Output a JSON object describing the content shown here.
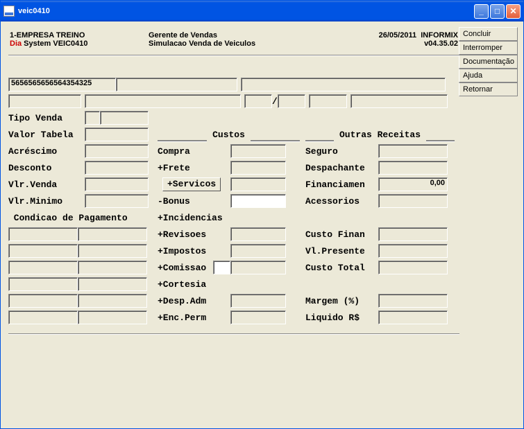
{
  "window": {
    "title": "veic0410"
  },
  "sidebar": {
    "concluir": "Concluir",
    "interromper": "Interromper",
    "documentacao": "Documentação",
    "ajuda": "Ajuda",
    "retornar": "Retornar"
  },
  "header": {
    "company": "1-EMPRESA TREINO",
    "role": "Gerente de Vendas",
    "date": "26/05/2011",
    "db": "INFORMIX",
    "dia": "Dia",
    "sys": " System  VEIC0410",
    "screen": "Simulacao Venda de Veiculos",
    "version": "v04.35.02"
  },
  "fields": {
    "big_input": "5656565656564354325",
    "slash": "/",
    "tipo_venda": "Tipo Venda",
    "valor_tabela": "Valor Tabela",
    "acrescimo": "Acréscimo",
    "desconto": "Desconto",
    "vlr_venda": "Vlr.Venda",
    "vlr_minimo": "Vlr.Minimo",
    "condicao": " Condicao de Pagamento",
    "custos_title": " Custos ",
    "compra": "Compra",
    "frete": "+Frete",
    "servicos": "+Servicos",
    "bonus": "-Bonus",
    "incidencias": "+Incidencias",
    "revisoes": "+Revisoes",
    "impostos": "+Impostos",
    "comissao": "+Comissao",
    "cortesia": "+Cortesia",
    "desp_adm": "+Desp.Adm",
    "enc_perm": "+Enc.Perm",
    "outras_title": " Outras Receitas ",
    "seguro": "Seguro",
    "despachante": "Despachante",
    "financiamen": "Financiamen",
    "financiamen_val": "0,00",
    "acessorios": "Acessorios",
    "custo_finan": "Custo Finan",
    "vl_presente": "Vl.Presente",
    "custo_total": "Custo Total",
    "margem": "Margem (%)",
    "liquido": "Liquido R$"
  }
}
